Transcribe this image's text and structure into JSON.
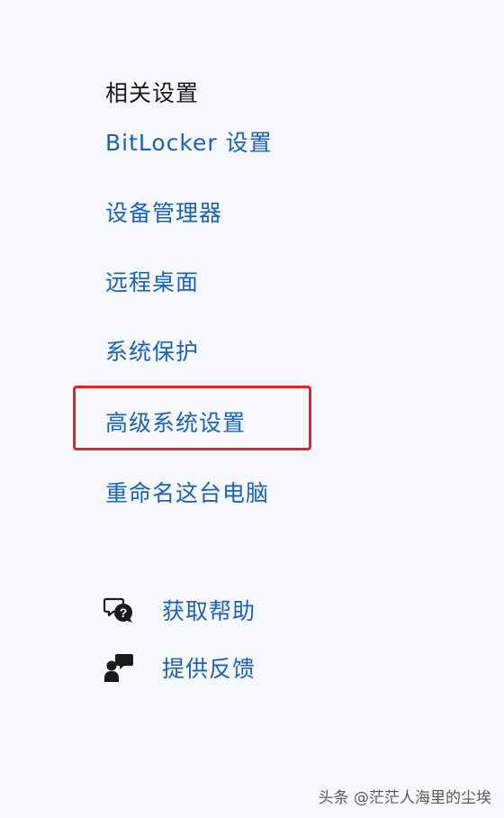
{
  "related_settings": {
    "title": "相关设置",
    "links": [
      {
        "label": "BitLocker 设置"
      },
      {
        "label": "设备管理器"
      },
      {
        "label": "远程桌面"
      },
      {
        "label": "系统保护"
      },
      {
        "label": "高级系统设置",
        "highlighted": true
      },
      {
        "label": "重命名这台电脑"
      }
    ]
  },
  "support": {
    "items": [
      {
        "icon": "help-chat-icon",
        "label": "获取帮助"
      },
      {
        "icon": "feedback-icon",
        "label": "提供反馈"
      }
    ]
  },
  "colors": {
    "link": "#1a62b8",
    "highlight_border": "#e0262b",
    "background": "#f7f8fb"
  },
  "watermark": {
    "text": "头条 @茫茫人海里的尘埃"
  }
}
